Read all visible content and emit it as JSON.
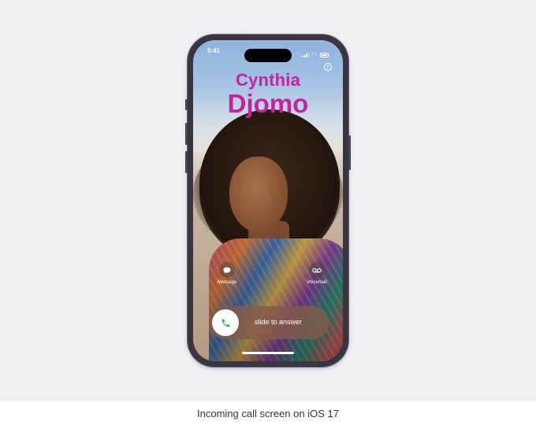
{
  "status_bar": {
    "time": "9:41",
    "wifi_icon": "wifi-icon",
    "battery_icon": "battery-icon",
    "signal_icon": "signal-icon"
  },
  "caller": {
    "first_name": "Cynthia",
    "last_name": "Djomo",
    "name_color": "#c2259b"
  },
  "info_icon": "info-icon",
  "actions": [
    {
      "label": "Message",
      "icon": "message-bubble-icon"
    },
    {
      "label": "Voicemail",
      "icon": "voicemail-icon"
    }
  ],
  "answer_slider": {
    "label": "slide to answer",
    "icon": "phone-icon",
    "icon_color": "#2fb24a"
  },
  "caption": "Incoming call screen on iOS 17"
}
